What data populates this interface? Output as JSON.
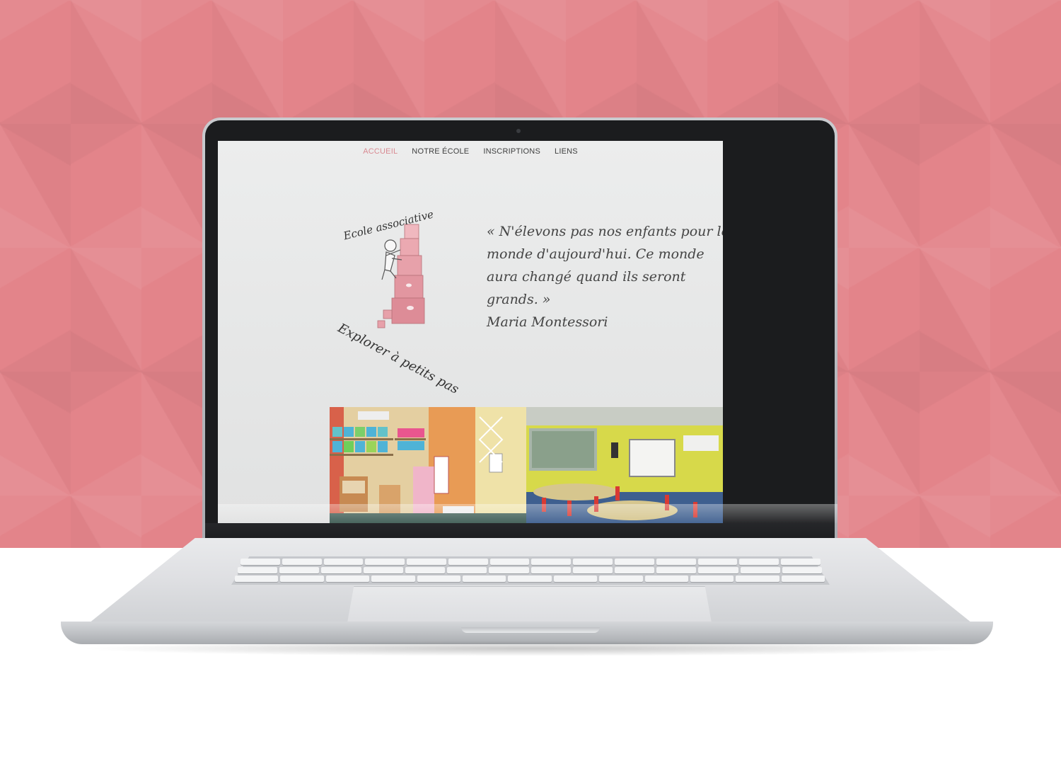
{
  "nav": {
    "items": [
      {
        "label": "ACCUEIL",
        "active": true
      },
      {
        "label": "NOTRE ÉCOLE",
        "active": false
      },
      {
        "label": "INSCRIPTIONS",
        "active": false
      },
      {
        "label": "LIENS",
        "active": false
      }
    ],
    "active_color": "#d98a92"
  },
  "logo": {
    "top_text": "Ecole associative",
    "bottom_text": "Explorer à petits pas"
  },
  "quote": {
    "lines": [
      "« N'élevons pas nos enfants pour le",
      "monde d'aujourd'hui. Ce monde",
      "aura changé quand ils seront",
      "grands. »"
    ],
    "author": "Maria Montessori"
  },
  "colors": {
    "backdrop": "#e3848a",
    "logo_pink": "#e7a1aa"
  },
  "icons": [
    "logo-blocks-icon",
    "child-figure-icon"
  ]
}
